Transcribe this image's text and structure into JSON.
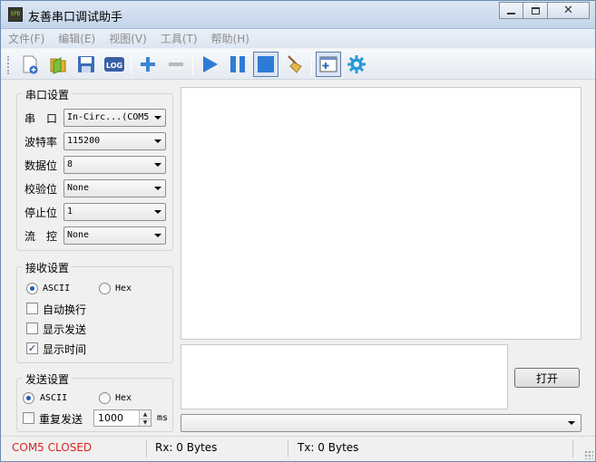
{
  "window": {
    "title": "友善串口调试助手",
    "app_icon_text": "SPD",
    "controls": [
      "minimize",
      "maximize",
      "close"
    ]
  },
  "menu": [
    "文件(F)",
    "编辑(E)",
    "视图(V)",
    "工具(T)",
    "帮助(H)"
  ],
  "toolbar": {
    "buttons": [
      {
        "name": "new-icon",
        "checked": false
      },
      {
        "name": "open-icon",
        "checked": false
      },
      {
        "name": "save-icon",
        "checked": false
      },
      {
        "name": "log-icon",
        "label": "LOG",
        "checked": false
      },
      {
        "name": "add-icon",
        "checked": false
      },
      {
        "name": "remove-icon",
        "checked": false
      },
      {
        "name": "play-icon",
        "checked": false
      },
      {
        "name": "pause-icon",
        "checked": false
      },
      {
        "name": "stop-icon",
        "checked": true
      },
      {
        "name": "clear-broom-icon",
        "checked": false
      },
      {
        "name": "add-window-icon",
        "checked": true
      },
      {
        "name": "settings-gear-icon",
        "checked": false
      }
    ]
  },
  "serial_settings": {
    "title": "串口设置",
    "fields": [
      {
        "label": "串　口",
        "value": "In-Circ...(COM5"
      },
      {
        "label": "波特率",
        "value": "115200"
      },
      {
        "label": "数据位",
        "value": "8"
      },
      {
        "label": "校验位",
        "value": "None"
      },
      {
        "label": "停止位",
        "value": "1"
      },
      {
        "label": "流　控",
        "value": "None"
      }
    ]
  },
  "receive_settings": {
    "title": "接收设置",
    "ascii_label": "ASCII",
    "hex_label": "Hex",
    "mode": "ASCII",
    "auto_wrap": {
      "label": "自动换行",
      "checked": false
    },
    "show_send": {
      "label": "显示发送",
      "checked": false
    },
    "show_time": {
      "label": "显示时间",
      "checked": true
    }
  },
  "send_settings": {
    "title": "发送设置",
    "ascii_label": "ASCII",
    "hex_label": "Hex",
    "mode": "ASCII",
    "repeat": {
      "label": "重复发送",
      "checked": false
    },
    "interval": "1000",
    "unit": "ms"
  },
  "open_button": "打开",
  "status": {
    "port": "COM5 CLOSED",
    "port_color": "#e02020",
    "rx": "Rx: 0 Bytes",
    "tx": "Tx: 0 Bytes"
  }
}
